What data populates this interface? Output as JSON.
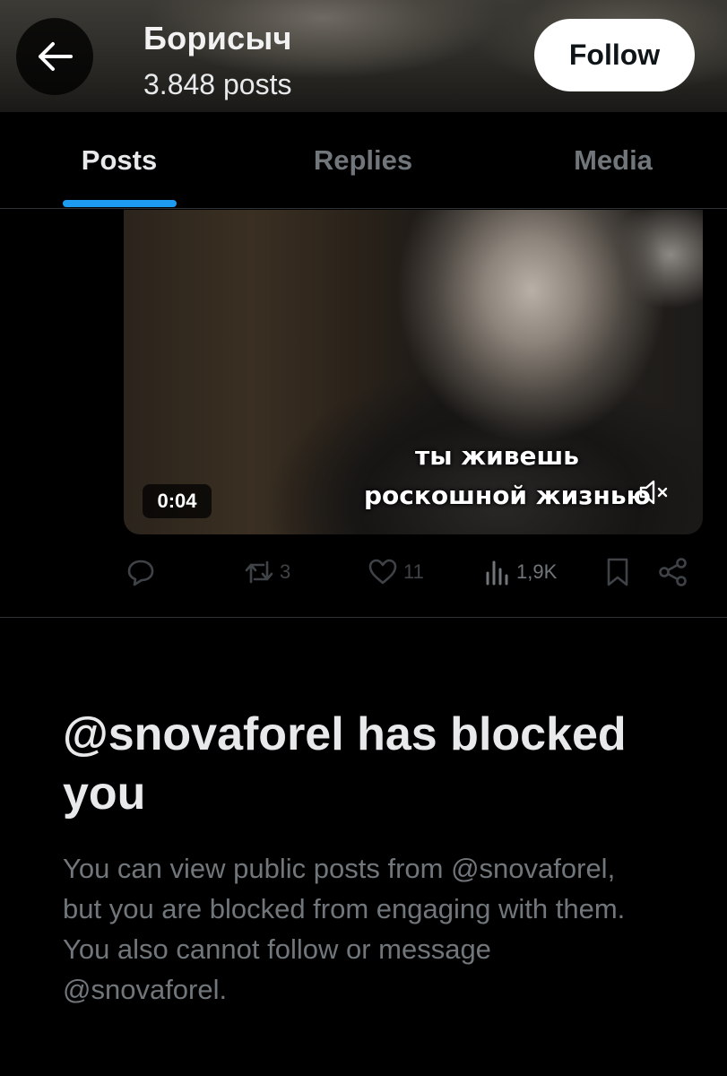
{
  "header": {
    "profile_name": "Борисыч",
    "posts_count": "3.848 posts",
    "follow_label": "Follow"
  },
  "tabs": [
    {
      "label": "Posts",
      "active": true
    },
    {
      "label": "Replies",
      "active": false
    },
    {
      "label": "Media",
      "active": false
    }
  ],
  "post": {
    "video": {
      "subtitle_line1": "ты живешь",
      "subtitle_line2": "роскошной жизнью",
      "duration": "0:04",
      "muted": true
    },
    "stats": {
      "replies": "",
      "reposts": "3",
      "likes": "11",
      "views": "1,9K"
    }
  },
  "blocked_notice": {
    "title": "@snovaforel has blocked you",
    "description": "You can view public posts from @snovaforel, but you are blocked from engaging with them. You also cannot follow or message @snovaforel."
  },
  "colors": {
    "accent": "#1d9bf0",
    "background": "#000000",
    "primary_text": "#e7e9ea",
    "secondary_text": "#71767b",
    "follow_button_bg": "#ffffff"
  },
  "icons": {
    "back": "arrow-left-icon",
    "reply": "reply-icon",
    "repost": "repost-icon",
    "like": "heart-icon",
    "views": "views-chart-icon",
    "bookmark": "bookmark-icon",
    "share": "share-icon",
    "mute": "speaker-muted-icon"
  }
}
